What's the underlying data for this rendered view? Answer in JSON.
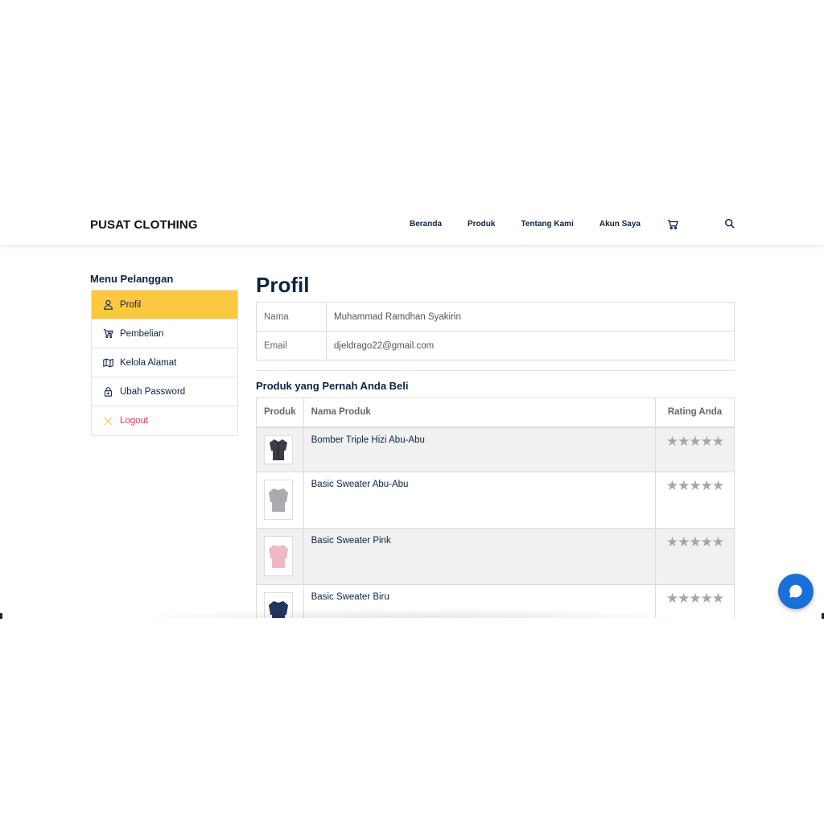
{
  "brand": "PUSAT CLOTHING",
  "nav": {
    "links": [
      "Beranda",
      "Produk",
      "Tentang Kami",
      "Akun Saya"
    ],
    "cart_icon": "cart-icon",
    "search_icon": "search-icon"
  },
  "sidebar": {
    "title": "Menu Pelanggan",
    "items": [
      {
        "label": "Profil",
        "icon": "user-icon",
        "active": true
      },
      {
        "label": "Pembelian",
        "icon": "cart-icon"
      },
      {
        "label": "Kelola Alamat",
        "icon": "map-icon"
      },
      {
        "label": "Ubah Password",
        "icon": "lock-icon"
      },
      {
        "label": "Logout",
        "icon": "close-icon"
      }
    ]
  },
  "profile": {
    "title": "Profil",
    "rows": [
      {
        "key": "Nama",
        "value": "Muhammad Ramdhan Syakirin"
      },
      {
        "key": "Email",
        "value": "djeldrago22@gmail.com"
      }
    ]
  },
  "purchases": {
    "title": "Produk yang Pernah Anda Beli",
    "headers": {
      "image": "Produk",
      "name": "Nama Produk",
      "rating": "Rating Anda"
    },
    "rows": [
      {
        "name": "Bomber Triple Hizi Abu-Abu",
        "thumb_color": "#3a3d44",
        "rating": 0
      },
      {
        "name": "Basic Sweater Abu-Abu",
        "thumb_color": "#a9abae",
        "rating": 0
      },
      {
        "name": "Basic Sweater Pink",
        "thumb_color": "#efb8c2",
        "rating": 0
      },
      {
        "name": "Basic Sweater Biru",
        "thumb_color": "#23365c",
        "rating": 0
      }
    ],
    "star_glyph": "★★★★★"
  },
  "colors": {
    "accent": "#fcc840",
    "primary_text": "#0d2340",
    "logout": "#e0344e",
    "chat": "#1a6fd9",
    "star": "#a6a6a6"
  },
  "chat_icon": "chat-bubble-icon"
}
